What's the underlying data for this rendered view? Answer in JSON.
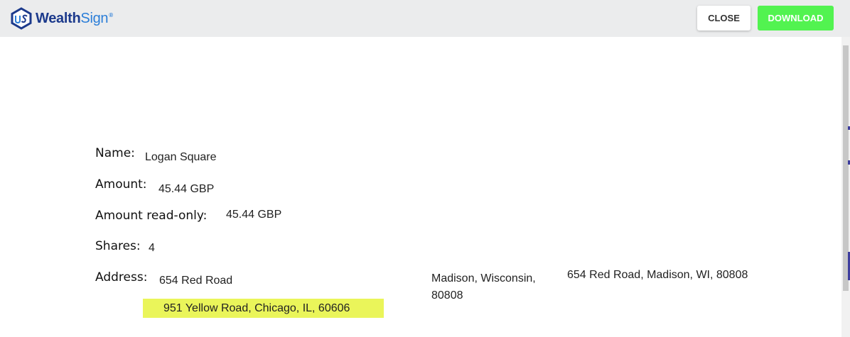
{
  "header": {
    "logo_main": "Wealth",
    "logo_accent": "Sign",
    "logo_mark": "®",
    "close_label": "CLOSE",
    "download_label": "DOWNLOAD"
  },
  "document": {
    "name_label": "Name:",
    "name_value": "Logan Square",
    "amount_label": "Amount:",
    "amount_value": "45.44 GBP",
    "amount_ro_label": "Amount read-only:",
    "amount_ro_value": "45.44 GBP",
    "shares_label": "Shares:",
    "shares_value": "4",
    "address_label": "Address:",
    "address_line1": "654 Red Road",
    "address_city_line1": "Madison, Wisconsin,",
    "address_city_line2": "80808",
    "address_full": "654 Red Road, Madison, WI, 80808",
    "address_highlight": "951 Yellow Road, Chicago, IL, 60606"
  },
  "colors": {
    "brand_dark": "#1c3a8c",
    "brand_light": "#2b7ed8",
    "download_bg": "#52f350",
    "highlight_bg": "#eaf55a",
    "header_bg": "#ebeced"
  }
}
